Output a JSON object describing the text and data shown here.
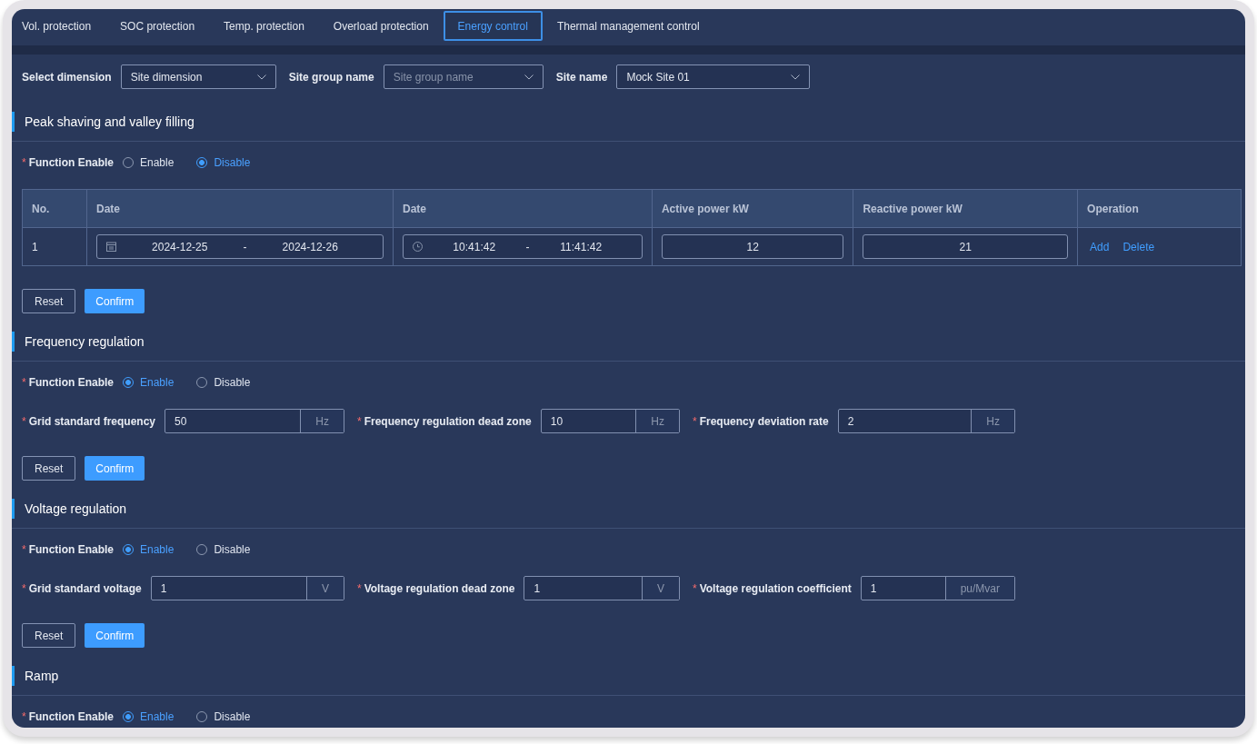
{
  "tabs": [
    {
      "label": "Vol. protection",
      "selected": false
    },
    {
      "label": "SOC protection",
      "selected": false
    },
    {
      "label": "Temp. protection",
      "selected": false
    },
    {
      "label": "Overload protection",
      "selected": false
    },
    {
      "label": "Energy control",
      "selected": true
    },
    {
      "label": "Thermal management control",
      "selected": false
    }
  ],
  "filters": [
    {
      "label": "Select dimension",
      "value": "Site dimension"
    },
    {
      "label": "Site group name",
      "placeholder": "Site group name"
    },
    {
      "label": "Site name",
      "value": "Mock Site 01"
    }
  ],
  "sections": [
    {
      "title": "Peak shaving and valley filling",
      "enable": {
        "mark": "*",
        "label": "Function Enable",
        "options": [
          {
            "label": "Enable",
            "selected": false
          },
          {
            "label": "Disable",
            "selected": true
          }
        ]
      },
      "table": {
        "columns": [
          "No.",
          "Date",
          "Date",
          "Active power kW",
          "Reactive power kW",
          "Operation"
        ],
        "rows": [
          {
            "no": "1",
            "date_range": {
              "start": "2024-12-25",
              "separator": "-",
              "end": "2024-12-26"
            },
            "time_range": {
              "start": "10:41:42",
              "separator": "-",
              "end": "11:41:42"
            },
            "active_power": "12",
            "reactive_power": "21",
            "actions": [
              "Add",
              "Delete"
            ]
          }
        ]
      },
      "buttons": [
        {
          "label": "Reset",
          "kind": "default"
        },
        {
          "label": "Confirm",
          "kind": "primary"
        }
      ]
    },
    {
      "title": "Frequency regulation",
      "enable": {
        "mark": "*",
        "label": "Function Enable",
        "options": [
          {
            "label": "Enable",
            "selected": true
          },
          {
            "label": "Disable",
            "selected": false
          }
        ]
      },
      "fields": [
        {
          "mark": "*",
          "label": "Grid standard frequency",
          "value": "50",
          "unit": "Hz"
        },
        {
          "mark": "*",
          "label": "Frequency regulation dead zone",
          "value": "10",
          "unit": "Hz"
        },
        {
          "mark": "*",
          "label": "Frequency deviation rate",
          "value": "2",
          "unit": "Hz"
        }
      ],
      "buttons": [
        {
          "label": "Reset",
          "kind": "default"
        },
        {
          "label": "Confirm",
          "kind": "primary"
        }
      ]
    },
    {
      "title": "Voltage regulation",
      "enable": {
        "mark": "*",
        "label": "Function Enable",
        "options": [
          {
            "label": "Enable",
            "selected": true
          },
          {
            "label": "Disable",
            "selected": false
          }
        ]
      },
      "fields": [
        {
          "mark": "*",
          "label": "Grid standard voltage",
          "value": "1",
          "unit": "V"
        },
        {
          "mark": "*",
          "label": "Voltage regulation dead zone",
          "value": "1",
          "unit": "V"
        },
        {
          "mark": "*",
          "label": "Voltage regulation coefficient",
          "value": "1",
          "unit": "pu/Mvar"
        }
      ],
      "buttons": [
        {
          "label": "Reset",
          "kind": "default"
        },
        {
          "label": "Confirm",
          "kind": "primary"
        }
      ]
    },
    {
      "title": "Ramp",
      "enable": {
        "mark": "*",
        "label": "Function Enable",
        "options": [
          {
            "label": "Enable",
            "selected": true
          },
          {
            "label": "Disable",
            "selected": false
          }
        ]
      }
    }
  ]
}
